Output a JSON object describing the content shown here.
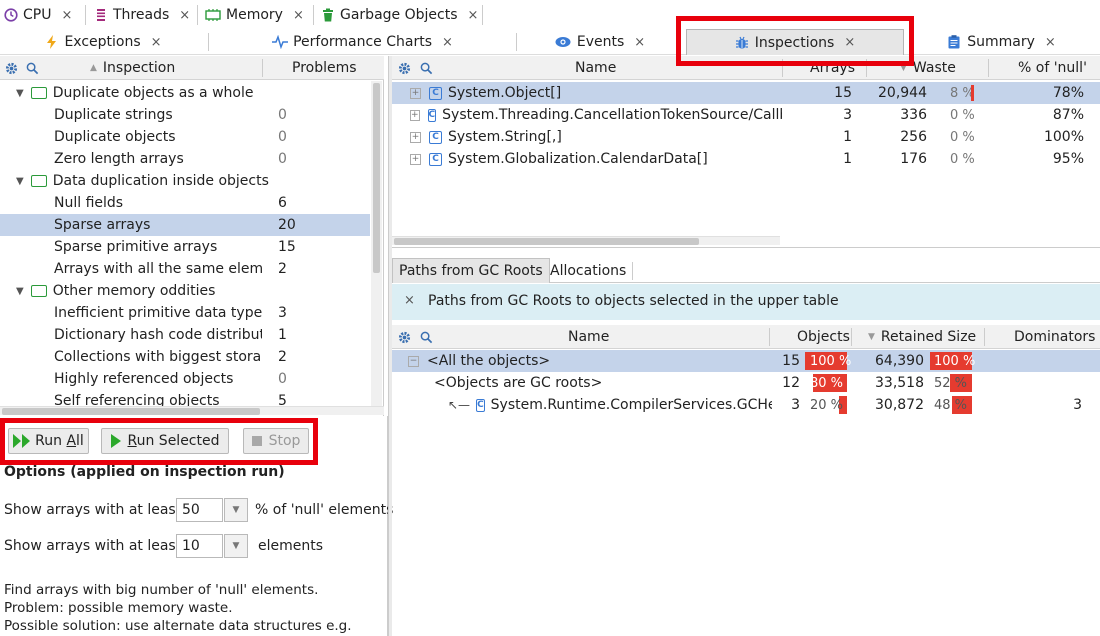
{
  "top_tabs": [
    {
      "label": "CPU",
      "icon": "clock-icon"
    },
    {
      "label": "Threads",
      "icon": "threads-icon"
    },
    {
      "label": "Memory",
      "icon": "memory-icon"
    },
    {
      "label": "Garbage Objects",
      "icon": "trash-icon"
    }
  ],
  "second_tabs": [
    {
      "label": "Exceptions",
      "icon": "lightning-icon"
    },
    {
      "label": "Performance Charts",
      "icon": "pulse-icon"
    },
    {
      "label": "Events",
      "icon": "eye-icon"
    },
    {
      "label": "Inspections",
      "icon": "bug-icon",
      "active": true
    },
    {
      "label": "Summary",
      "icon": "clipboard-icon"
    }
  ],
  "close_glyph": "×",
  "left_tree": {
    "col_inspection": "Inspection",
    "col_problems": "Problems",
    "rows": [
      {
        "label": "Duplicate objects as a whole",
        "problems": "",
        "group": true
      },
      {
        "label": "Duplicate strings",
        "problems": "0"
      },
      {
        "label": "Duplicate objects",
        "problems": "0"
      },
      {
        "label": "Zero length arrays",
        "problems": "0"
      },
      {
        "label": "Data duplication inside objects",
        "problems": "",
        "group": true
      },
      {
        "label": "Null fields",
        "problems": "6"
      },
      {
        "label": "Sparse arrays",
        "problems": "20",
        "selected": true
      },
      {
        "label": "Sparse primitive arrays",
        "problems": "15"
      },
      {
        "label": "Arrays with all the same elemen",
        "problems": "2"
      },
      {
        "label": "Other memory oddities",
        "problems": "",
        "group": true
      },
      {
        "label": "Inefficient primitive data type us",
        "problems": "3"
      },
      {
        "label": "Dictionary hash code distributio",
        "problems": "1"
      },
      {
        "label": "Collections with biggest storage",
        "problems": "2"
      },
      {
        "label": "Highly referenced objects",
        "problems": "0"
      },
      {
        "label": "Self referencing objects",
        "problems": "5"
      }
    ]
  },
  "buttons": {
    "run_all": "Run All",
    "run_selected": "Run Selected",
    "stop": "Stop"
  },
  "options": {
    "title": "Options (applied on inspection run)",
    "row1_prefix": "Show arrays with at least",
    "row1_value": "50",
    "row1_suffix": "% of 'null' elements",
    "row2_prefix": "Show arrays with at least",
    "row2_value": "10",
    "row2_suffix": "elements",
    "desc1": "Find arrays with big number of 'null' elements.",
    "desc2": "Problem: possible memory waste.",
    "desc3": "Possible solution: use alternate data structures e.g."
  },
  "upper_table": {
    "col_name": "Name",
    "col_arrays": "Arrays",
    "col_waste": "Waste",
    "col_pct_null": "% of 'null'",
    "rows": [
      {
        "name": "System.Object[]",
        "arrays": "15",
        "waste": "20,944",
        "waste_pct": "8 %",
        "pct_null": "78%",
        "selected": true
      },
      {
        "name": "System.Threading.CancellationTokenSource/Callba",
        "arrays": "3",
        "waste": "336",
        "waste_pct": "0 %",
        "pct_null": "87%"
      },
      {
        "name": "System.String[,]",
        "arrays": "1",
        "waste": "256",
        "waste_pct": "0 %",
        "pct_null": "100%"
      },
      {
        "name": "System.Globalization.CalendarData[]",
        "arrays": "1",
        "waste": "176",
        "waste_pct": "0 %",
        "pct_null": "95%"
      }
    ]
  },
  "lower_tabs": {
    "paths": "Paths from GC Roots",
    "allocations": "Allocations"
  },
  "info_bar": "Paths from GC Roots to objects selected in the upper table",
  "lower_table": {
    "col_name": "Name",
    "col_objects": "Objects",
    "col_retained": "Retained Size",
    "col_dominators": "Dominators",
    "rows": [
      {
        "name": "<All the objects>",
        "objects": "15",
        "objects_pct": "100 %",
        "objects_fill": 1.0,
        "retained": "64,390",
        "retained_pct": "100 %",
        "retained_fill": 1.0,
        "dominators": "",
        "selected": true
      },
      {
        "name": "<Objects are GC roots>",
        "objects": "12",
        "objects_pct": "80 %",
        "objects_fill": 0.8,
        "retained": "33,518",
        "retained_pct": "52 %",
        "retained_fill": 0.52,
        "dominators": ""
      },
      {
        "name": "System.Runtime.CompilerServices.GCHeap",
        "objects": "3",
        "objects_pct": "20 %",
        "objects_fill": 0.2,
        "retained": "30,872",
        "retained_pct": "48 %",
        "retained_fill": 0.48,
        "dominators": "3"
      }
    ]
  },
  "colors": {
    "highlight_red": "#e8000c",
    "bar_red": "#e53b2f",
    "selection_blue": "#c4d3ea",
    "info_bg": "#dbeef4",
    "accent_blue": "#3a7bd5",
    "group_green": "#2b9a3a"
  }
}
